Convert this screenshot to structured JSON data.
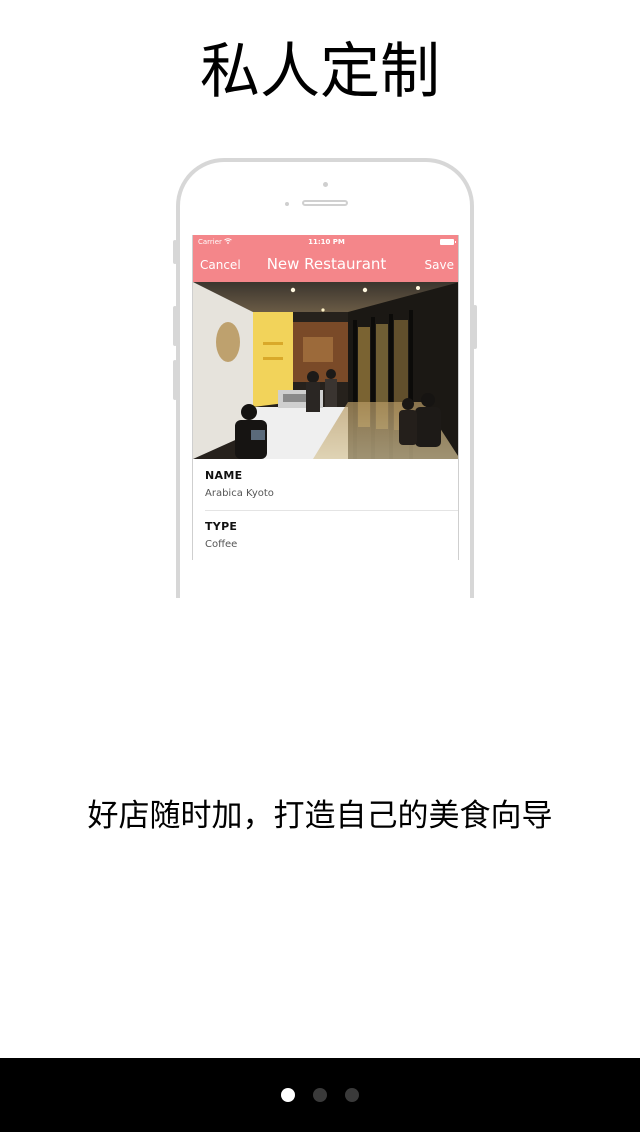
{
  "page": {
    "title": "私人定制",
    "subtitle": "好店随时加，打造自己的美食向导"
  },
  "phone": {
    "status_bar": {
      "carrier": "Carrier",
      "time": "11:10 PM"
    },
    "navbar": {
      "cancel_label": "Cancel",
      "title": "New Restaurant",
      "save_label": "Save",
      "color": "#f4868a"
    },
    "fields": [
      {
        "label": "NAME",
        "value": "Arabica Kyoto"
      },
      {
        "label": "TYPE",
        "value": "Coffee"
      }
    ]
  },
  "pager": {
    "count": 3,
    "active_index": 0,
    "active_color": "#ffffff",
    "inactive_color": "#3a3a3a"
  }
}
